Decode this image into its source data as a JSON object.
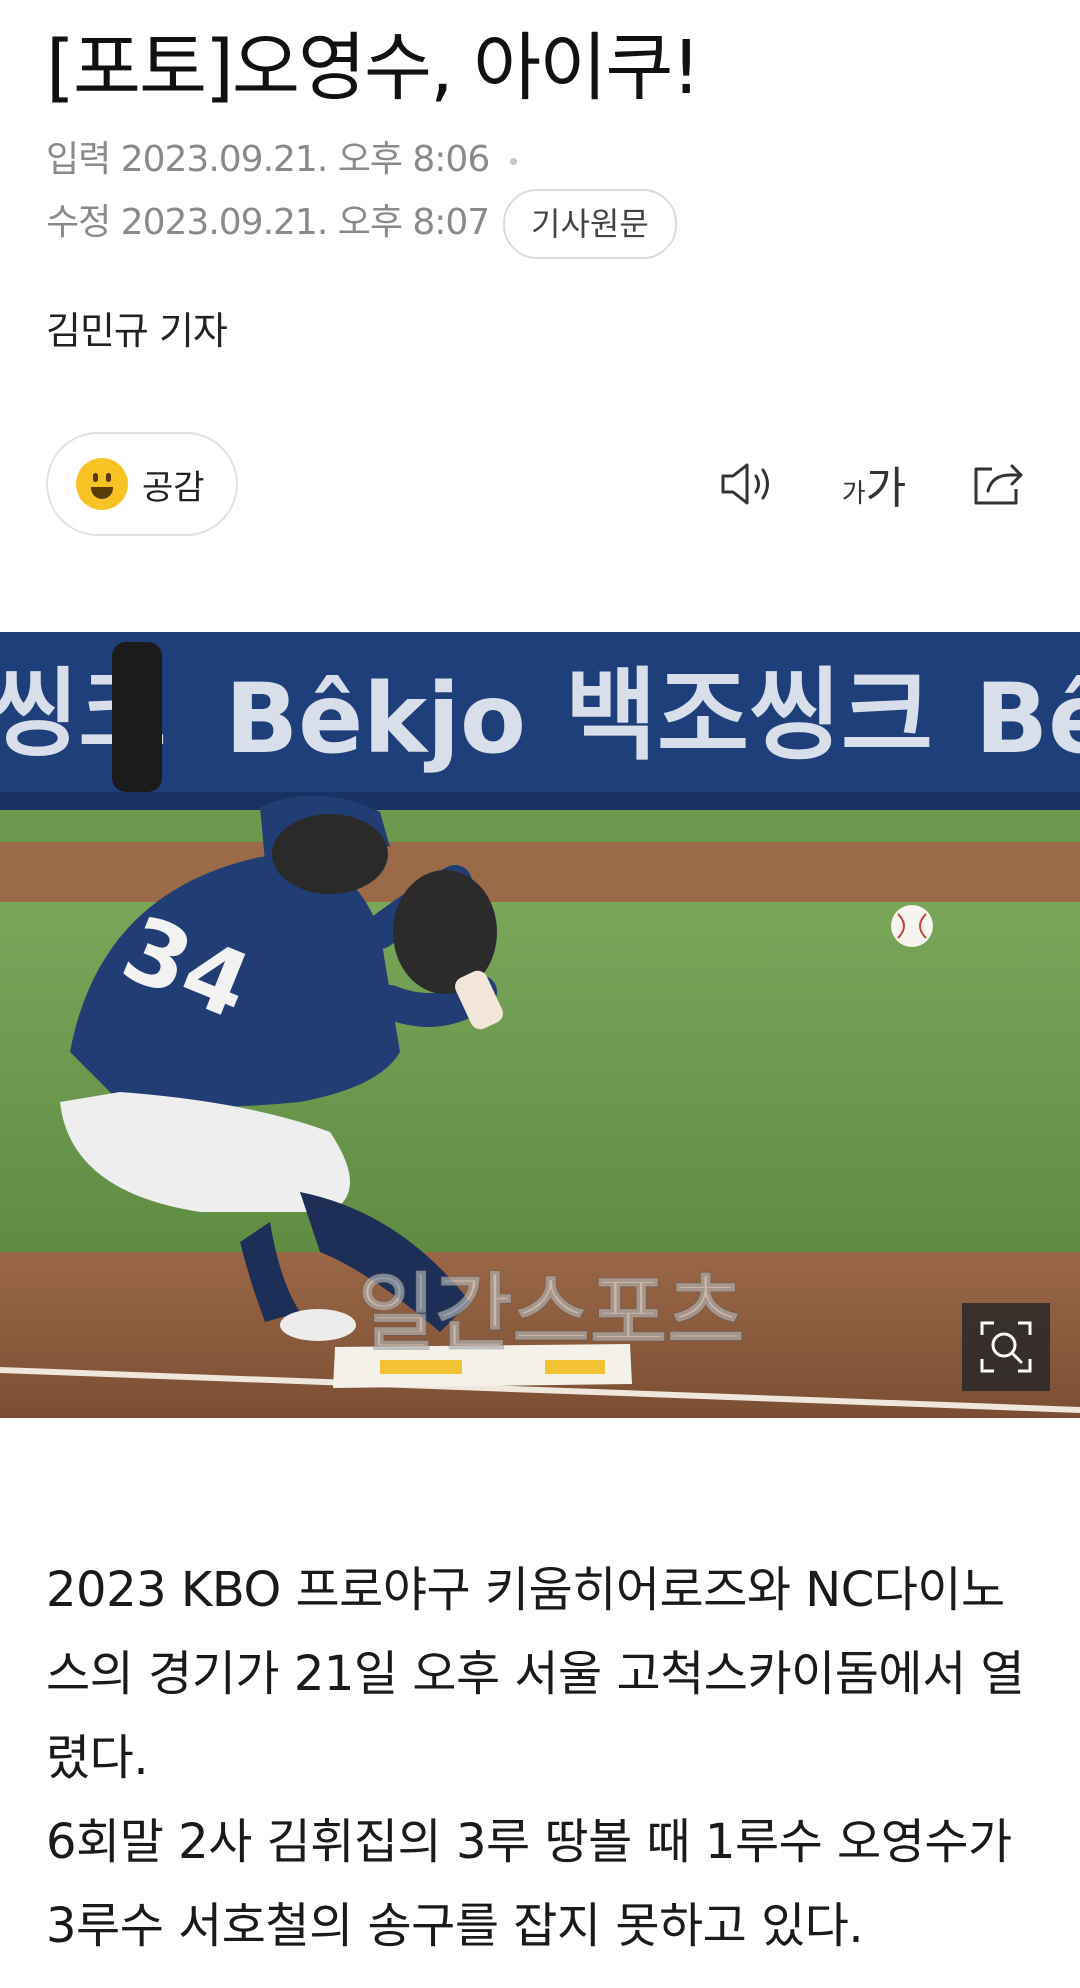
{
  "article": {
    "headline": "[포토]오영수, 아이쿠!",
    "input_label": "입력",
    "input_time": "2023.09.21. 오후 8:06",
    "modify_label": "수정",
    "modify_time": "2023.09.21. 오후 8:07",
    "original_button": "기사원문",
    "reporter": "김민규 기자"
  },
  "toolbar": {
    "empathy_label": "공감",
    "font_small": "가",
    "font_big": "가",
    "speaker_icon": "speaker-icon",
    "share_icon": "share-icon"
  },
  "photo": {
    "banner_text_1": "Bêkjo",
    "banner_text_2": "백조씽크",
    "jersey_number": "34",
    "watermark": "일간스포츠",
    "zoom_icon": "magnify-icon"
  },
  "body": {
    "paragraph_1": "2023 KBO 프로야구 키움히어로즈와 NC다이노스의 경기가 21일 오후 서울 고척스카이돔에서 열렸다.",
    "paragraph_2": "6회말 2사 김휘집의 3루 땅볼 때 1루수 오영수가 3루수 서호철의 송구를 잡지 못하고 있다."
  },
  "colors": {
    "meta_gray": "#8a8a8a",
    "emoji_yellow": "#f7c224",
    "banner_navy": "#1f3f7a",
    "grass_green": "#6f9a4c",
    "dirt_brown": "#8b5a3c"
  }
}
